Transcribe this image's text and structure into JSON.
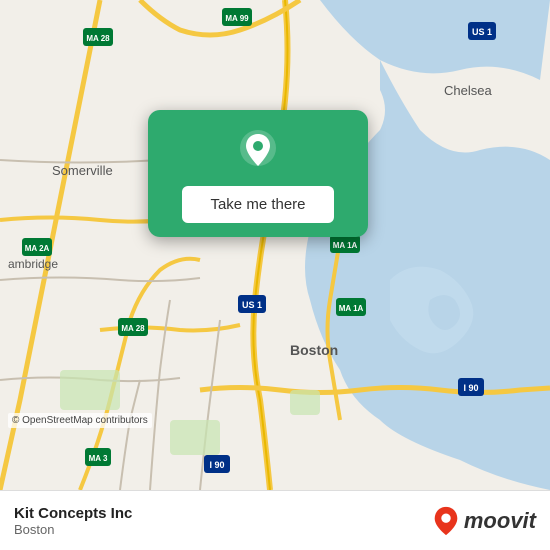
{
  "map": {
    "attribution": "© OpenStreetMap contributors",
    "bg_color": "#e8e0d8"
  },
  "popup": {
    "button_label": "Take me there",
    "pin_color": "#ffffff",
    "card_color": "#2eaa6e"
  },
  "bottom_bar": {
    "business_name": "Kit Concepts Inc",
    "city": "Boston",
    "moovit_text": "moovit"
  }
}
